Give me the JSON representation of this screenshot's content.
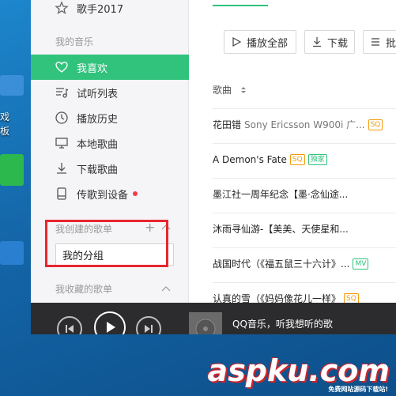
{
  "desktop": {
    "labels": [
      "戏",
      "板"
    ]
  },
  "sidebar": {
    "singer_item": "歌手2017",
    "my_music_heading": "我的音乐",
    "items": [
      {
        "label": "我喜欢",
        "icon": "heart-icon",
        "active": true
      },
      {
        "label": "试听列表",
        "icon": "playlist-icon"
      },
      {
        "label": "播放历史",
        "icon": "clock-icon"
      },
      {
        "label": "本地歌曲",
        "icon": "monitor-icon"
      },
      {
        "label": "下载歌曲",
        "icon": "download-icon"
      },
      {
        "label": "传歌到设备",
        "icon": "device-icon",
        "dot": true
      }
    ],
    "created_heading": "我创建的歌单",
    "new_playlist_value": "我的分组",
    "collected_heading": "我收藏的歌单"
  },
  "main": {
    "toolbar": {
      "play_all": "播放全部",
      "download": "下载",
      "batch": "批"
    },
    "column_header": "歌曲",
    "songs": [
      {
        "title": "花田错",
        "sub": "Sony Ericsson W900i 广...",
        "badges": [
          "SQ"
        ]
      },
      {
        "title": "A Demon's Fate",
        "sub": "",
        "badges": [
          "SQ",
          "独家"
        ]
      },
      {
        "title": "墨江社一周年纪念【墨·念仙途...",
        "sub": "",
        "badges": []
      },
      {
        "title": "沐雨寻仙游-【美美、天使星和...",
        "sub": "",
        "badges": []
      },
      {
        "title": "战国时代（《福五鼠三十六计》...",
        "sub": "",
        "badges": [
          "MV"
        ]
      },
      {
        "title": "认真的雪（《妈妈像花儿一样》",
        "sub": "",
        "badges": [
          "SQ"
        ]
      }
    ]
  },
  "player": {
    "now_playing": "QQ音乐，听我想听的歌"
  },
  "watermark": {
    "text": "aspku.com",
    "sub": "免费网站源码下载站!"
  }
}
